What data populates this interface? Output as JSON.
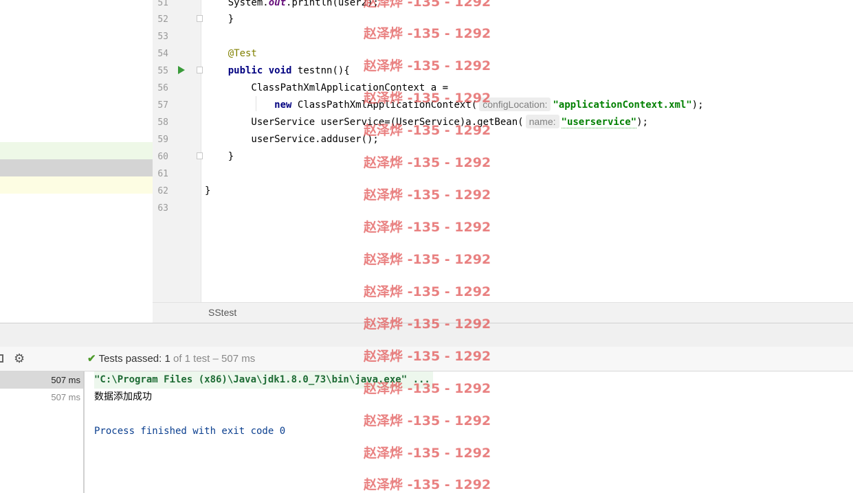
{
  "editor": {
    "line_numbers": [
      "51",
      "52",
      "53",
      "54",
      "55",
      "56",
      "57",
      "58",
      "59",
      "60",
      "61",
      "62",
      "63"
    ],
    "lines": {
      "l51": {
        "pre": "    System.",
        "field": "out",
        "post": ".println(user2);"
      },
      "l52": "    }",
      "l54": "    @Test",
      "l55": {
        "kw1": "public",
        "kw2": "void",
        "rest": "testnn(){"
      },
      "l56": "        ClassPathXmlApplicationContext a =",
      "l57": {
        "kw": "new",
        "call": "ClassPathXmlApplicationContext(",
        "hint": "configLocation:",
        "str": "\"applicationContext.xml\"",
        "end": ");"
      },
      "l58": {
        "pre": "        UserService userService=(UserService)a.getBean(",
        "hint": "name:",
        "str": "\"userservice\"",
        "end": ");"
      },
      "l59": "        userService.adduser();",
      "l60": "    }",
      "l62": "}"
    },
    "file_tab": "SStest"
  },
  "test_panel": {
    "status_check_icon": "check-icon",
    "status_label": "Tests passed:",
    "passed_count": "1",
    "status_rest": "of 1 test – 507 ms",
    "tree": [
      {
        "duration": "507 ms"
      },
      {
        "duration": "507 ms"
      }
    ]
  },
  "console": {
    "command": "\"C:\\Program Files (x86)\\Java\\jdk1.8.0_73\\bin\\java.exe\" ...",
    "output": "数据添加成功",
    "exit": "Process finished with exit code 0"
  },
  "watermark": {
    "text": "赵泽烨 -135 - 1292",
    "color": "#e05050"
  },
  "colors": {
    "keyword": "#000080",
    "string": "#008000",
    "annotation": "#808000",
    "run_icon": "#3a9b3a"
  }
}
